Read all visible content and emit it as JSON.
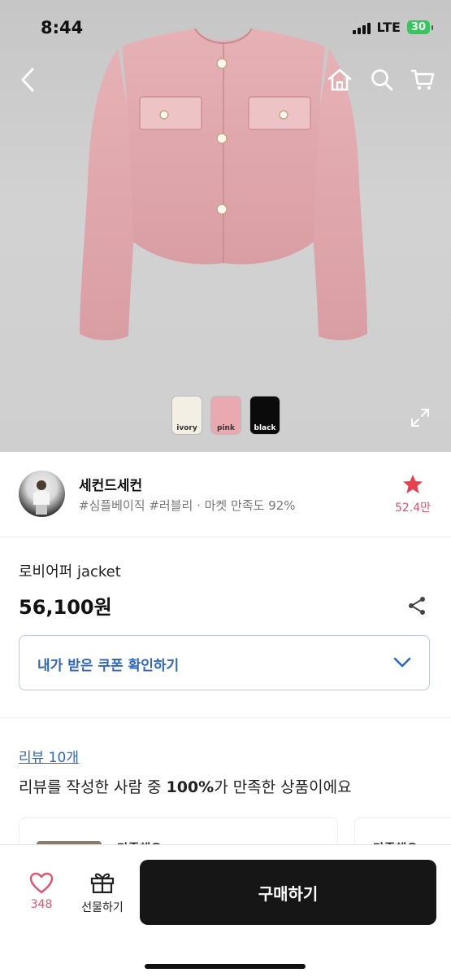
{
  "status": {
    "time": "8:44",
    "network": "LTE",
    "battery": "30"
  },
  "product_swatches": [
    {
      "label": "ivory",
      "color": "#f3efe4"
    },
    {
      "label": "pink",
      "color": "#e9a9b0"
    },
    {
      "label": "black",
      "color": "#0b0b0b"
    }
  ],
  "seller": {
    "name": "세컨드세컨",
    "tags": "#심플베이직 #러블리 · 마켓 만족도 92%",
    "favorite_count": "52.4만"
  },
  "product": {
    "name": "로비어퍼 jacket",
    "price": "56,100원",
    "coupon_label": "내가 받은 쿠폰 확인하기"
  },
  "reviews": {
    "link_label": "리뷰 10개",
    "summary_pre": "리뷰를 작성한 사람 중 ",
    "summary_pct": "100%",
    "summary_post": "가 만족한 상품이에요",
    "cards": [
      {
        "text": "만족해요"
      },
      {
        "text": "만족해요"
      }
    ]
  },
  "bottom_bar": {
    "like_count": "348",
    "gift_label": "선물하기",
    "buy_label": "구매하기"
  },
  "colors": {
    "accent_blue": "#2f66c2",
    "accent_pink": "#e0546e",
    "star_red": "#e8404f",
    "buy_bg": "#161616"
  },
  "icons": [
    "back-arrow-icon",
    "home-icon",
    "search-icon",
    "cart-icon",
    "expand-icon",
    "star-icon",
    "share-icon",
    "chevron-down-icon",
    "heart-icon",
    "gift-icon"
  ]
}
